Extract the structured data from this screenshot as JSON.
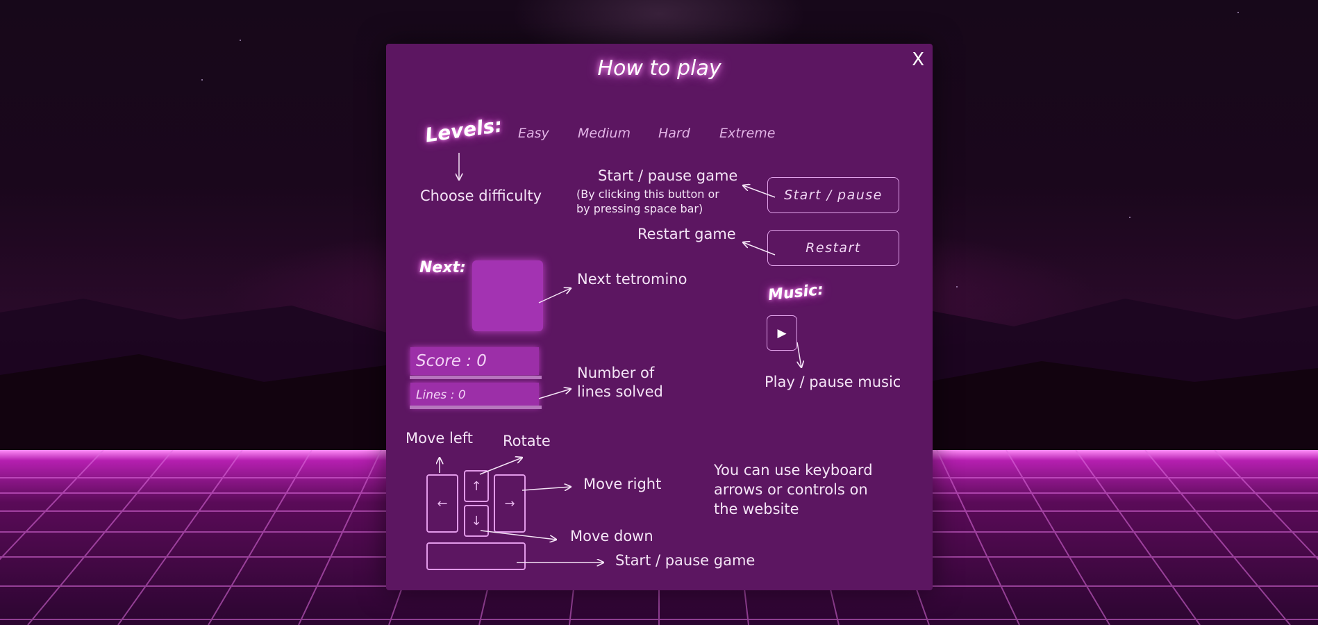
{
  "modal": {
    "title": "How to play",
    "close_label": "X"
  },
  "levels": {
    "title": "Levels:",
    "options": [
      "Easy",
      "Medium",
      "Hard",
      "Extreme"
    ],
    "annotation": "Choose difficulty"
  },
  "controls": {
    "start_pause_label": "Start / pause",
    "start_pause_annotation": "Start / pause game",
    "start_pause_note": "(By clicking this button or by pressing space bar)",
    "restart_label": "Restart",
    "restart_annotation": "Restart game"
  },
  "next": {
    "title": "Next:",
    "annotation": "Next tetromino"
  },
  "stats": {
    "score_text": "Score : 0",
    "lines_text": "Lines : 0",
    "annotation_line1": "Number of",
    "annotation_line2": "lines solved"
  },
  "music": {
    "title": "Music:",
    "play_icon": "▶",
    "annotation": "Play / pause music"
  },
  "keyboard": {
    "move_left": "Move left",
    "rotate": "Rotate",
    "move_right": "Move right",
    "move_down": "Move down",
    "start_pause": "Start / pause game",
    "key_left": "←",
    "key_up": "↑",
    "key_down": "↓",
    "key_right": "→",
    "note_line1": "You can use keyboard",
    "note_line2": "arrows or controls on",
    "note_line3": "the website"
  },
  "colors": {
    "modal_bg": "#5c1661",
    "neon_pink": "#ff9cf7",
    "tile_purple": "#a333b2"
  }
}
